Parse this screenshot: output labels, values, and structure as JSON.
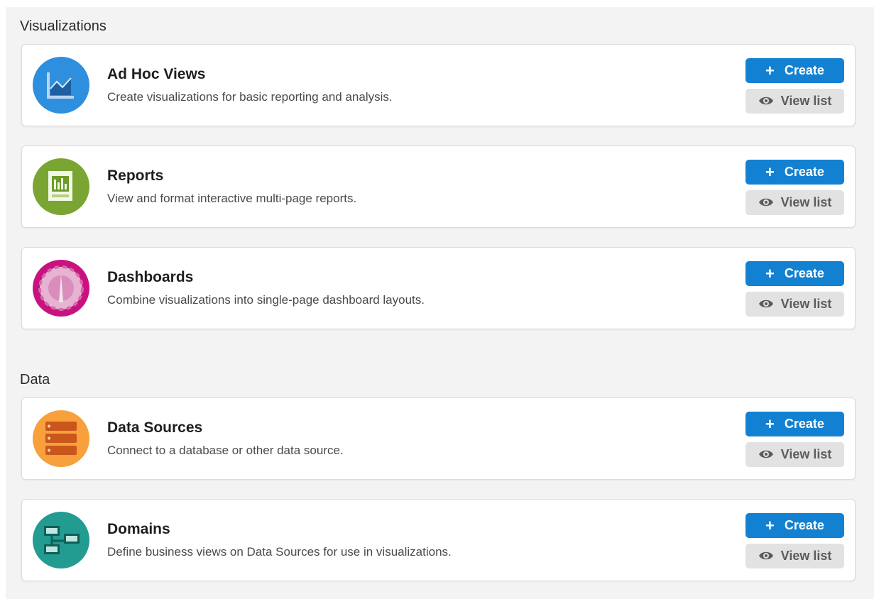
{
  "sections": {
    "visualizations": {
      "title": "Visualizations",
      "cards": [
        {
          "title": "Ad Hoc Views",
          "description": "Create visualizations for basic reporting and analysis.",
          "icon": "chart-icon",
          "color": "#2f8fdf"
        },
        {
          "title": "Reports",
          "description": "View and format interactive multi-page reports.",
          "icon": "report-icon",
          "color": "#7aa532"
        },
        {
          "title": "Dashboards",
          "description": "Combine visualizations into single-page dashboard layouts.",
          "icon": "gauge-icon",
          "color": "#c8127f"
        }
      ]
    },
    "data": {
      "title": "Data",
      "cards": [
        {
          "title": "Data Sources",
          "description": "Connect to a database or other data source.",
          "icon": "database-icon",
          "color": "#f7a03c"
        },
        {
          "title": "Domains",
          "description": "Define business views on Data Sources for use in visualizations.",
          "icon": "domain-icon",
          "color": "#229b91"
        }
      ]
    }
  },
  "buttons": {
    "create_label": "Create",
    "view_list_label": "View list",
    "create_icon": "plus-icon",
    "view_icon": "eye-icon"
  },
  "colors": {
    "create_bg": "#1381d1",
    "view_bg": "#e2e2e2",
    "page_bg": "#f3f3f3"
  }
}
